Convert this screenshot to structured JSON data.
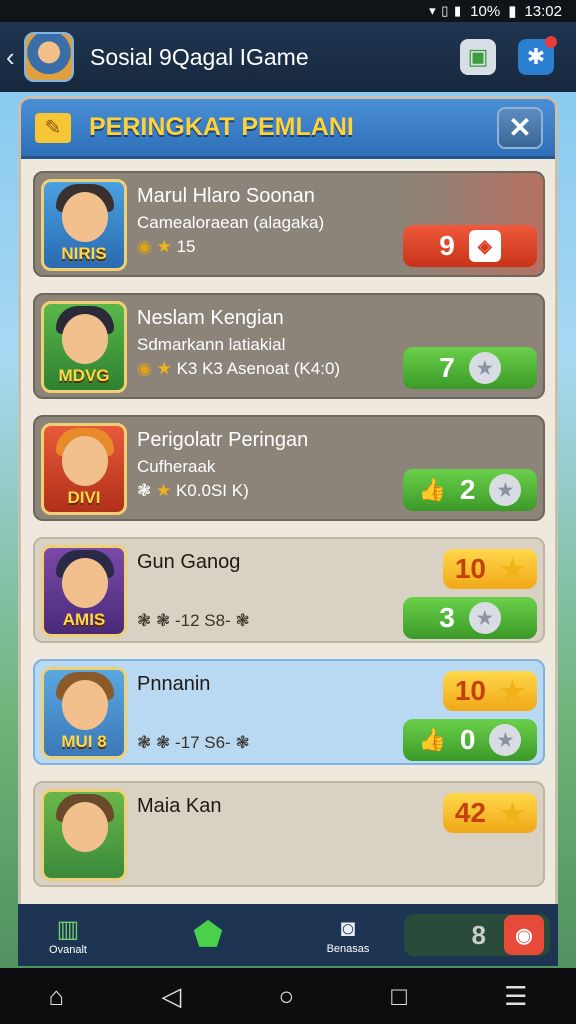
{
  "status_bar": {
    "battery": "10%",
    "time": "13:02"
  },
  "app_bar": {
    "title": "Sosial 9Qagal IGame"
  },
  "panel": {
    "title": "PERINGKAT PEMLANI",
    "close": "✕"
  },
  "players": [
    {
      "name": "Marul Hlaro Soonan",
      "sub": "Camealoraean (alagaka)",
      "stats": "15",
      "tag": "NIRIS",
      "score": "9",
      "style": "red"
    },
    {
      "name": "Neslam Kengian",
      "sub": "Sdmarkann latiakial",
      "stats": "K3 K3 Asenoat (K4:0)",
      "tag": "MDVG",
      "score": "7",
      "style": "green"
    },
    {
      "name": "Perigolatr Peringan",
      "sub": "Cufheraak",
      "stats": "K0.0SI  K)",
      "tag": "DIVI",
      "score": "2",
      "style": "green"
    },
    {
      "name": "Gun Ganog",
      "sub": "",
      "stats": "-12 S8-",
      "tag": "AMIS",
      "score": "3",
      "gold": "10",
      "style": "green"
    },
    {
      "name": "Pnnanin",
      "sub": "",
      "stats": "-17 S6-",
      "tag": "MUI 8",
      "score": "0",
      "gold": "10",
      "style": "green"
    },
    {
      "name": "Maia Kan",
      "sub": "",
      "stats": "",
      "tag": "",
      "score": "",
      "gold": "42",
      "style": "gold"
    }
  ],
  "bottom_nav": {
    "left": "Ovanalt",
    "center": "",
    "camera": "Benasas",
    "score": "8"
  },
  "colors": {
    "header": "#2e6fb8",
    "title_gold": "#ffd23a",
    "green": "#3b9a28",
    "red": "#c83218"
  }
}
